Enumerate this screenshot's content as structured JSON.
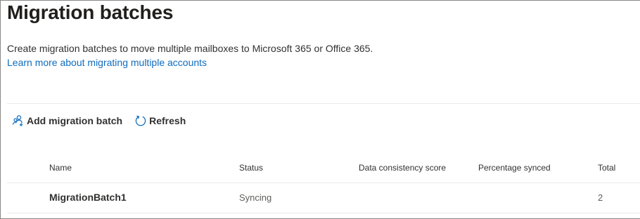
{
  "page": {
    "title": "Migration batches",
    "description": "Create migration batches to move multiple mailboxes to Microsoft 365 or Office 365.",
    "learn_more_link": "Learn more about migrating multiple accounts"
  },
  "toolbar": {
    "add_label": "Add migration batch",
    "add_icon": "add-people-icon",
    "refresh_label": "Refresh",
    "refresh_icon": "refresh-icon"
  },
  "table": {
    "columns": [
      "Name",
      "Status",
      "Data consistency score",
      "Percentage synced",
      "Total"
    ],
    "rows": [
      {
        "name": "MigrationBatch1",
        "status": "Syncing",
        "data_consistency_score": "",
        "percentage_synced": "",
        "total": "2"
      }
    ]
  },
  "colors": {
    "link": "#0f6cbd",
    "icon_accent": "#0f6cbd",
    "title": "#201f1e",
    "divider": "#edebe9"
  }
}
